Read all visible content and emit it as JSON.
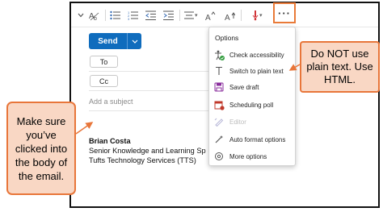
{
  "toolbar": {
    "more_label": "···"
  },
  "compose": {
    "send_label": "Send",
    "to_label": "To",
    "cc_label": "Cc",
    "subject_placeholder": "Add a subject"
  },
  "signature": {
    "name": "Brian Costa",
    "title": "Senior Knowledge and Learning Sp",
    "org": "Tufts Technology Services (TTS)"
  },
  "menu": {
    "header": "Options",
    "items": [
      {
        "label": "Check accessibility",
        "icon": "accessibility-icon",
        "enabled": true
      },
      {
        "label": "Switch to plain text",
        "icon": "text-icon",
        "enabled": true
      },
      {
        "label": "Save draft",
        "icon": "save-icon",
        "enabled": true
      },
      {
        "label": "Scheduling poll",
        "icon": "calendar-poll-icon",
        "enabled": true
      },
      {
        "label": "Editor",
        "icon": "editor-pen-icon",
        "enabled": false
      },
      {
        "label": "Auto format options",
        "icon": "auto-format-icon",
        "enabled": true
      },
      {
        "label": "More options",
        "icon": "more-options-icon",
        "enabled": true
      }
    ]
  },
  "callouts": {
    "left": "Make sure you’ve clicked into the body of the email.",
    "right": "Do NOT use plain text. Use HTML."
  },
  "colors": {
    "accent": "#0f6cbd",
    "callout_fill": "#f9d7c4",
    "callout_border": "#e8763a"
  }
}
